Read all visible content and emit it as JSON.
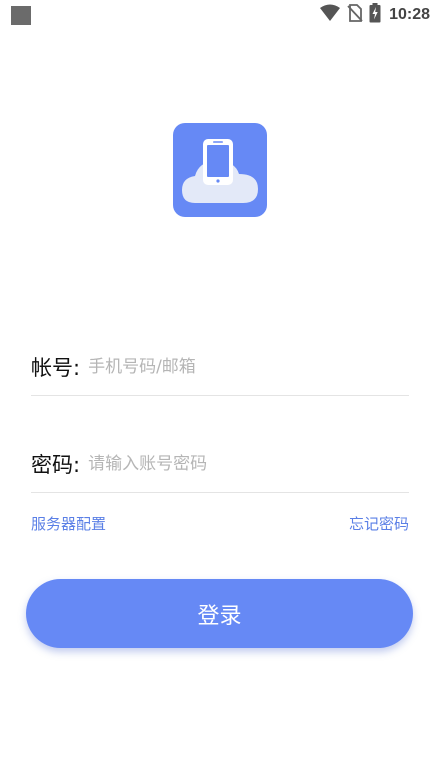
{
  "status_bar": {
    "time": "10:28",
    "icons": [
      "notification-square-icon",
      "wifi-icon",
      "no-sim-icon",
      "battery-charging-icon"
    ]
  },
  "logo": {
    "icon": "phone-on-cloud-icon",
    "bg_color": "#6689f5"
  },
  "form": {
    "account_label": "帐号:",
    "account_placeholder": "手机号码/邮箱",
    "account_value": "",
    "password_label": "密码:",
    "password_placeholder": "请输入账号密码",
    "password_value": ""
  },
  "links": {
    "server_config": "服务器配置",
    "forgot_password": "忘记密码"
  },
  "login_button": {
    "label": "登录"
  },
  "colors": {
    "accent": "#6689f5",
    "link": "#5a7fe6",
    "divider": "#e4e4e4",
    "placeholder": "#b5b5b5"
  }
}
